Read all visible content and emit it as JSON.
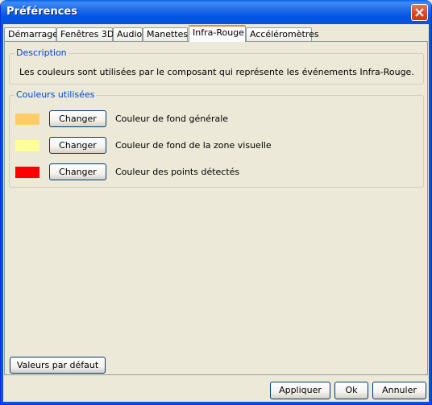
{
  "window": {
    "title": "Préférences"
  },
  "tabs": [
    {
      "label": "Démarrage"
    },
    {
      "label": "Fenêtres 3D"
    },
    {
      "label": "Audio"
    },
    {
      "label": "Manettes"
    },
    {
      "label": "Infra-Rouge",
      "active": true
    },
    {
      "label": "Accéléromètres"
    }
  ],
  "description": {
    "title": "Description",
    "text": "Les couleurs sont utilisées par le composant qui représente les événements Infra-Rouge."
  },
  "colors": {
    "title": "Couleurs utilisées",
    "items": [
      {
        "swatch": "#FFCC66",
        "button": "Changer",
        "label": "Couleur de fond générale"
      },
      {
        "swatch": "#FFFF99",
        "button": "Changer",
        "label": "Couleur de fond de la zone visuelle"
      },
      {
        "swatch": "#FF0000",
        "button": "Changer",
        "label": "Couleur des points détectés"
      }
    ]
  },
  "buttons": {
    "defaults": "Valeurs par défaut",
    "apply": "Appliquer",
    "ok": "Ok",
    "cancel": "Annuler"
  }
}
